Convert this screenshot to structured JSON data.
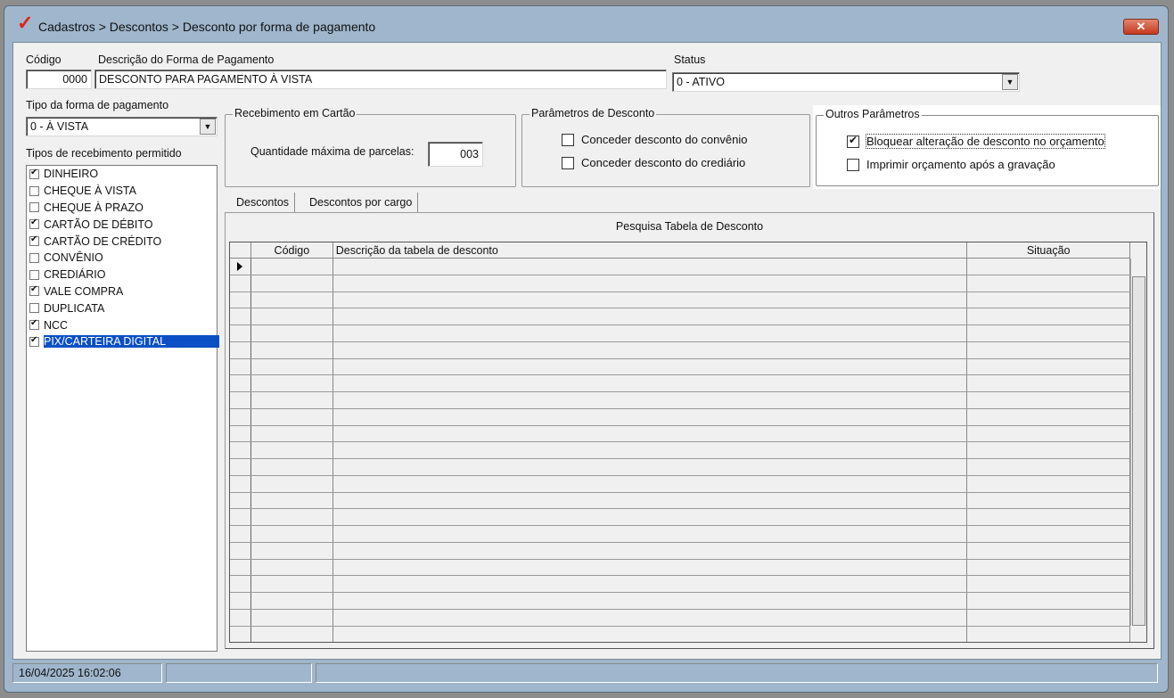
{
  "window": {
    "title": "Cadastros > Descontos > Desconto por forma de pagamento",
    "close_label": "✕"
  },
  "header": {
    "codigo_label": "Código",
    "codigo_value": "0000",
    "descricao_label": "Descrição do Forma de Pagamento",
    "descricao_value": "DESCONTO PARA PAGAMENTO À VISTA",
    "status_label": "Status",
    "status_value": "0 - ATIVO"
  },
  "tipo_forma": {
    "label": "Tipo da forma de pagamento",
    "value": "0 - À VISTA"
  },
  "tipos_recebimento": {
    "label": "Tipos de recebimento permitido",
    "items": [
      {
        "label": "DINHEIRO",
        "checked": true
      },
      {
        "label": "CHEQUE À VISTA",
        "checked": false
      },
      {
        "label": "CHEQUE À PRAZO",
        "checked": false
      },
      {
        "label": "CARTÃO DE DÉBITO",
        "checked": true
      },
      {
        "label": "CARTÃO DE CRÉDITO",
        "checked": true
      },
      {
        "label": "CONVÊNIO",
        "checked": false
      },
      {
        "label": "CREDIÁRIO",
        "checked": false
      },
      {
        "label": "VALE COMPRA",
        "checked": true
      },
      {
        "label": "DUPLICATA",
        "checked": false
      },
      {
        "label": "NCC",
        "checked": true
      },
      {
        "label": "PIX/CARTEIRA DIGITAL",
        "checked": true,
        "selected": true
      }
    ]
  },
  "recebimento_cartao": {
    "title": "Recebimento em Cartão",
    "parcelas_label": "Quantidade máxima de parcelas:",
    "parcelas_value": "003"
  },
  "parametros_desconto": {
    "title": "Parâmetros de Desconto",
    "convenio_label": "Conceder desconto do convênio",
    "convenio_checked": false,
    "crediario_label": "Conceder desconto do crediário",
    "crediario_checked": false
  },
  "outros_parametros": {
    "title": "Outros Parâmetros",
    "bloquear_label": "Bloquear alteração de desconto no orçamento",
    "bloquear_checked": true,
    "imprimir_label": "Imprimir orçamento após a gravação",
    "imprimir_checked": false
  },
  "tabs": [
    {
      "label": "Descontos",
      "active": true
    },
    {
      "label": "Descontos por cargo",
      "active": false
    }
  ],
  "grid": {
    "caption": "Pesquisa Tabela de Desconto",
    "columns": [
      "Código",
      "Descrição da tabela de desconto",
      "Situação"
    ],
    "empty_rows": 23
  },
  "statusbar": {
    "datetime": "16/04/2025 16:02:06",
    "panel2": "",
    "panel3": ""
  },
  "colors": {
    "selection": "#0a4fc4",
    "title_check": "#e2231a"
  }
}
